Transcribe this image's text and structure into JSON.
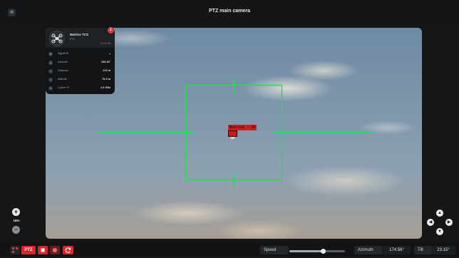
{
  "window": {
    "title": "PTZ main camera",
    "close_glyph": "⊗"
  },
  "target_card": {
    "name": "Matrice TCS",
    "type": "PTZ",
    "time": "12:47:33",
    "alert_count": "1",
    "rows": [
      {
        "icon": "signal-icon",
        "label": "Signal RI",
        "value": ""
      },
      {
        "icon": "azimuth-icon",
        "label": "Azimuth",
        "value": "103.16°"
      },
      {
        "icon": "distance-icon",
        "label": "Distance",
        "value": "213 m"
      },
      {
        "icon": "altitude-icon",
        "label": "Altitude",
        "value": "76.3 m"
      },
      {
        "icon": "frequency-icon",
        "label": "Carrier Fr",
        "value": "2.4 GHz"
      }
    ]
  },
  "tracking": {
    "label": "Matrice - 30"
  },
  "zoom": {
    "in": "+",
    "out": "−",
    "level": "16%"
  },
  "bottom_bar": {
    "ptz_label": "PTZ",
    "speed_label": "Speed",
    "speed_level": 0.6,
    "azimuth_label": "Azimuth",
    "azimuth_value": "174.56°",
    "tilt_label": "Tilt",
    "tilt_value": "23.15°"
  },
  "colors": {
    "reticle": "#21e04a",
    "track_red": "#e3161d",
    "accent_red": "#d9262e"
  }
}
